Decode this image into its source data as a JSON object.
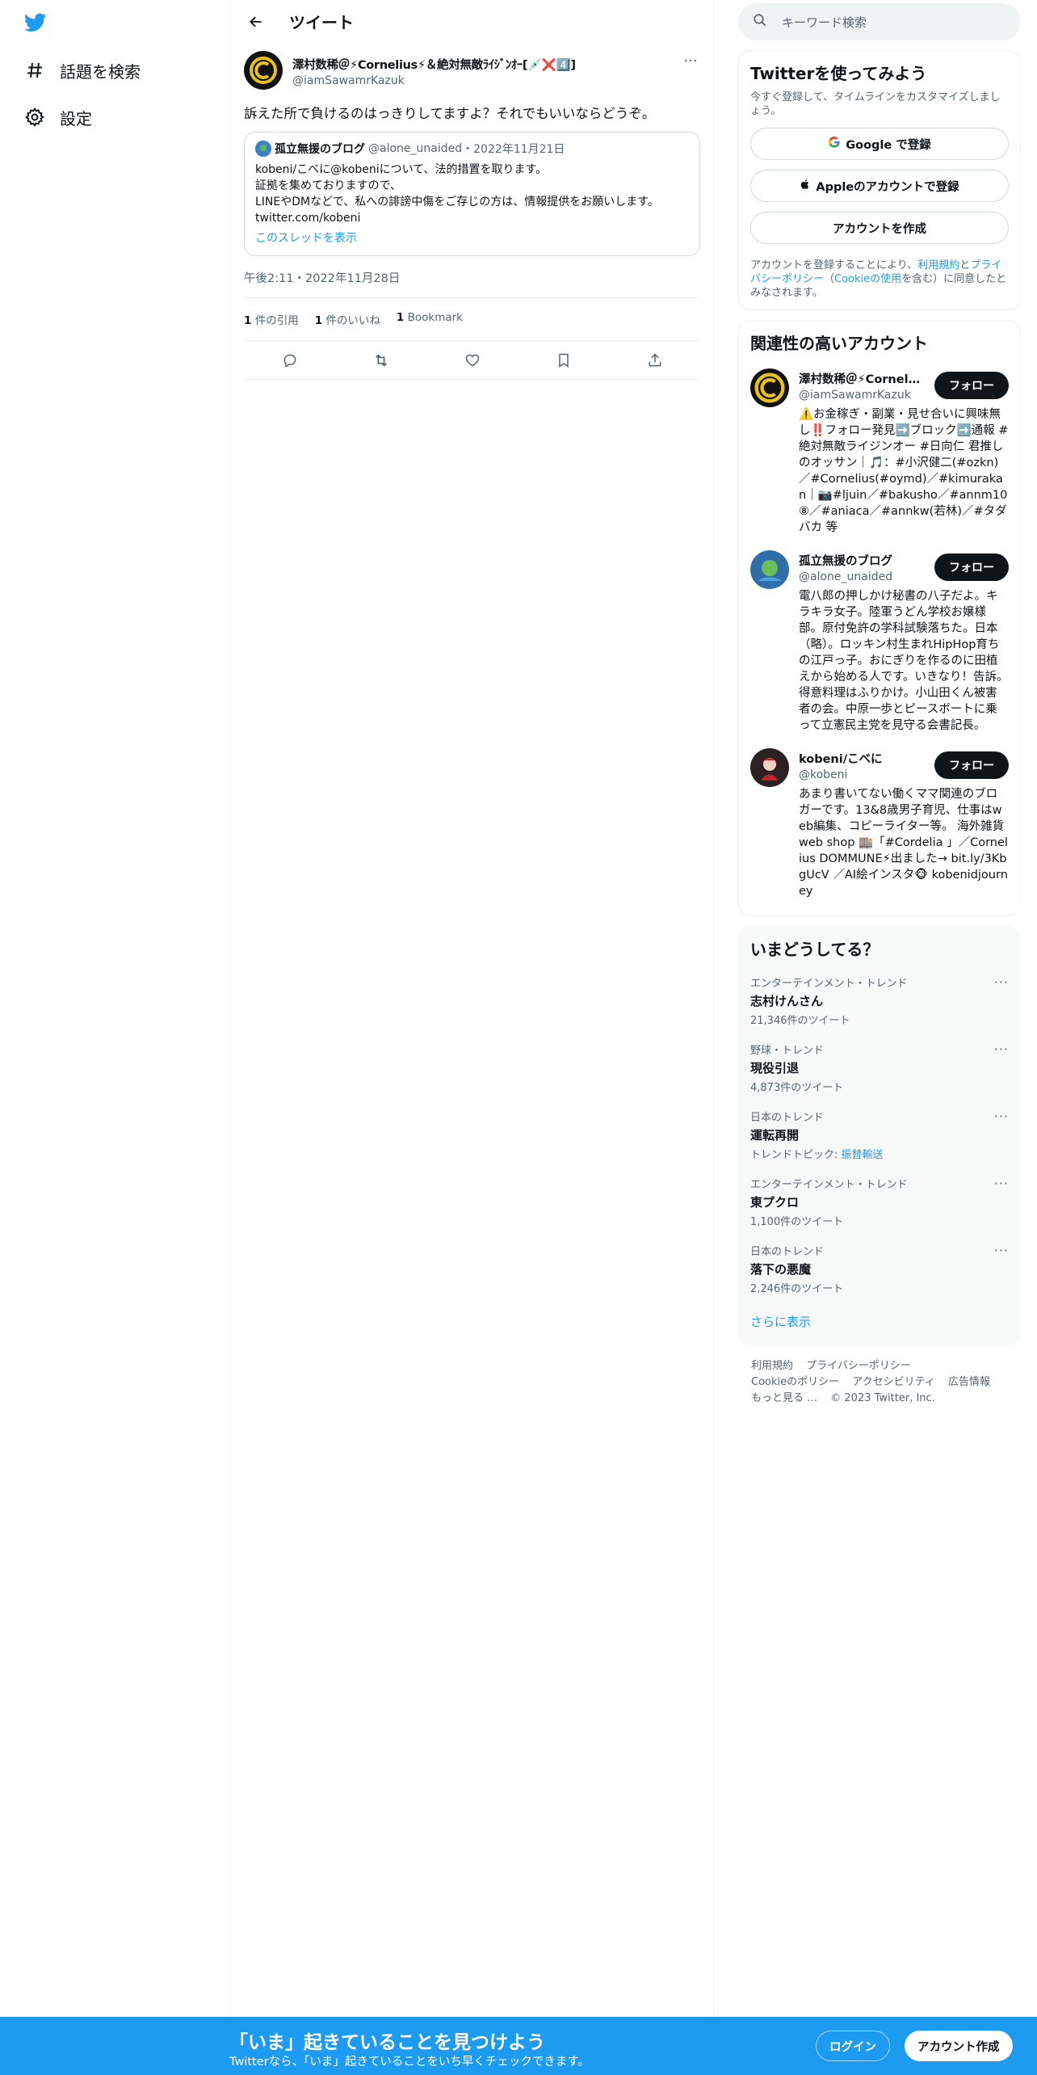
{
  "nav": {
    "items": [
      {
        "label": "話題を検索",
        "icon": "hashtag-icon"
      },
      {
        "label": "設定",
        "icon": "gear-icon"
      }
    ]
  },
  "header": {
    "title": "ツイート"
  },
  "tweet": {
    "author_name": "澤村数稀＠⚡Cornelius⚡＆絶対無敵ﾗｲｼﾞﾝｵｰ[💉❌4️⃣]",
    "author_handle": "@iamSawamrKazuk",
    "text": "訴えた所で負けるのはっきりしてますよ？それでもいいならどうぞ。",
    "quote": {
      "name": "孤立無援のブログ",
      "handle": "@alone_unaided",
      "date": "・2022年11月21日",
      "lines": [
        "kobeni/こべに@kobeniについて、法的措置を取ります。",
        "証拠を集めておりますので、",
        "LINEやDMなどで、私への誹謗中傷をご存じの方は、情報提供をお願いします。",
        "twitter.com/kobeni"
      ],
      "thread_link": "このスレッドを表示"
    },
    "timestamp": "午後2:11・2022年11月28日",
    "stats": [
      {
        "count": "1",
        "label": "件の引用"
      },
      {
        "count": "1",
        "label": "件のいいね"
      },
      {
        "count": "1",
        "label": "Bookmark"
      }
    ]
  },
  "search": {
    "placeholder": "キーワード検索"
  },
  "signup_card": {
    "title": "Twitterを使ってみよう",
    "subtitle": "今すぐ登録して、タイムラインをカスタマイズしましょう。",
    "google": "Google で登録",
    "apple": "Appleのアカウントで登録",
    "create": "アカウントを作成",
    "legal_prefix": "アカウントを登録することにより、",
    "legal_terms": "利用規約",
    "legal_and": "と",
    "legal_privacy": "プライバシーポリシー",
    "legal_cookie_open": "（",
    "legal_cookie": "Cookieの使用",
    "legal_suffix": "を含む）に同意したとみなされます。"
  },
  "related": {
    "title": "関連性の高いアカウント",
    "follow_label": "フォロー",
    "accounts": [
      {
        "name": "澤村数稀＠⚡Cornelius⚡＆絶対無敵ﾗｲｼﾞﾝｵｰ",
        "handle": "@iamSawamrKazuk",
        "bio": "⚠️お金稼ぎ・副業・見せ合いに興味無し‼️フォロー発見➡️ブロック➡️通報 #絶対無敵ライジンオー #日向仁 君推しのオッサン｜🎵：#小沢健二(#ozkn)／#Cornelius(#oymd)／#kimurakan｜📷#ljuin／#bakusho／#annm10⑧／#aniaca／#annkw(若林)／#タダバカ 等"
      },
      {
        "name": "孤立無援のブログ",
        "handle": "@alone_unaided",
        "bio": "電八郎の押しかけ秘書の八子だよ。キラキラ女子。陸軍うどん学校お嬢様部。原付免許の学科試験落ちた。日本（略）。ロッキン村生まれHipHop育ちの江戸っ子。おにぎりを作るのに田植えから始める人です。いきなり！告訴。得意料理はふりかけ。小山田くん被害者の会。中原一歩とピースボートに乗って立憲民主党を見守る会書記長。"
      },
      {
        "name": "kobeni/こべに",
        "handle": "@kobeni",
        "bio": "あまり書いてない働くママ関連のブロガーです。13&8歳男子育児、仕事はweb編集、コピーライター等。 海外雑貨web shop 🏬「#Cordelia 」／Cornelius DOMMUNE⚡出ました→ bit.ly/3KbgUcV ／AI絵インスタ🐵 kobenidjourney"
      }
    ]
  },
  "trends": {
    "title": "いまどうしてる？",
    "items": [
      {
        "category": "エンターテインメント・トレンド",
        "name": "志村けんさん",
        "count": "21,346件のツイート"
      },
      {
        "category": "野球・トレンド",
        "name": "現役引退",
        "count": "4,873件のツイート"
      },
      {
        "category": "日本のトレンド",
        "name": "運転再開",
        "count": "トレンドトピック: ",
        "topic": "振替輸送"
      },
      {
        "category": "エンターテインメント・トレンド",
        "name": "東プクロ",
        "count": "1,100件のツイート"
      },
      {
        "category": "日本のトレンド",
        "name": "落下の悪魔",
        "count": "2,246件のツイート"
      }
    ],
    "show_more": "さらに表示"
  },
  "footer": {
    "links": [
      "利用規約",
      "プライバシーポリシー",
      "Cookieのポリシー",
      "アクセシビリティ",
      "広告情報",
      "もっと見る …"
    ],
    "copyright": "© 2023 Twitter, Inc."
  },
  "bottombar": {
    "title": "「いま」起きていることを見つけよう",
    "subtitle": "Twitterなら、「いま」起きていることをいち早くチェックできます。",
    "login": "ログイン",
    "signup": "アカウント作成"
  },
  "colors": {
    "accent": "#1d9bf0",
    "text": "#0f1419",
    "muted": "#536471",
    "border": "#eff3f4"
  }
}
